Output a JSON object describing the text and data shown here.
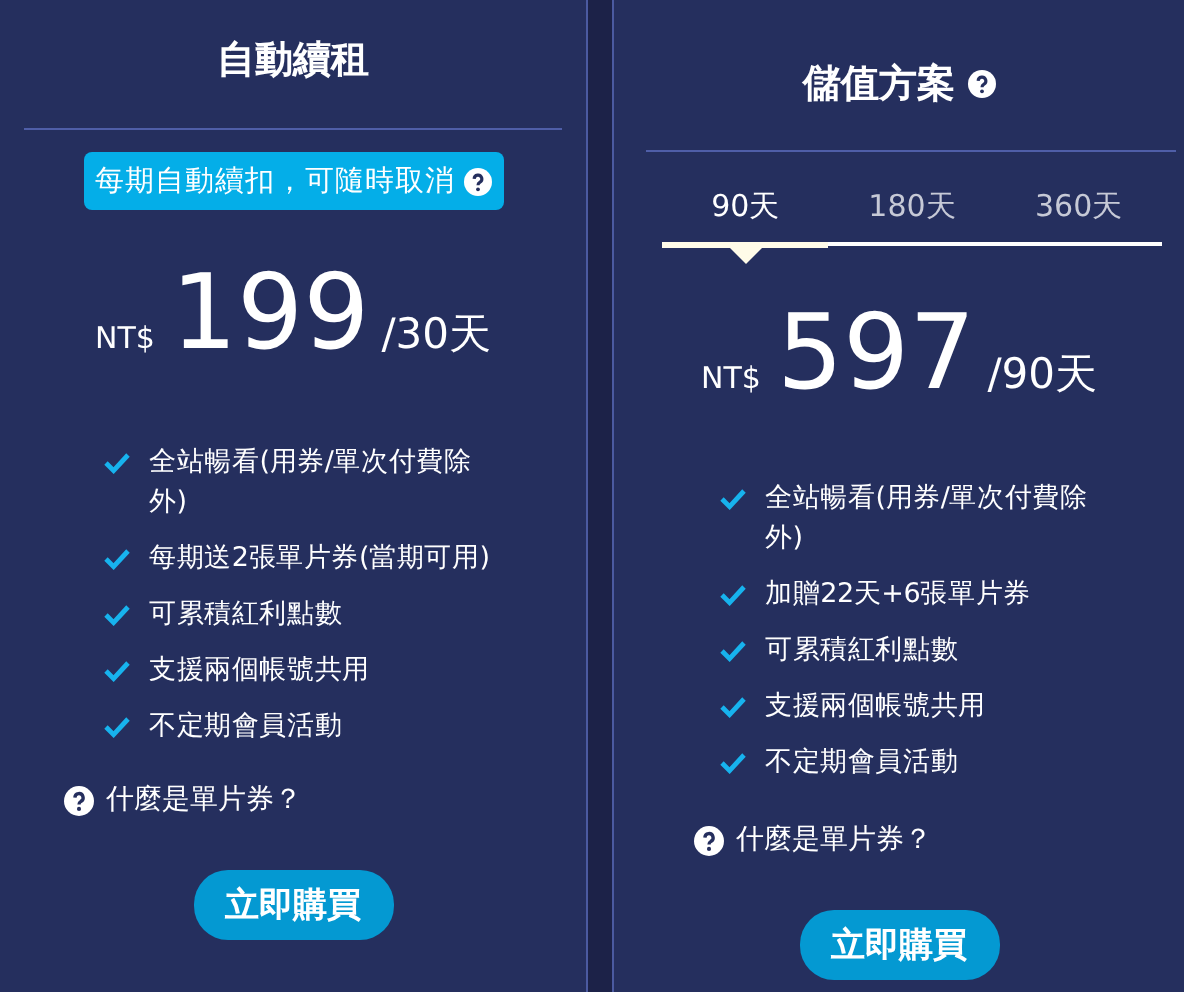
{
  "auto_renew": {
    "title": "自動續租",
    "badge": {
      "text": "每期自動續扣，可隨時取消",
      "help": true
    },
    "price": {
      "currency": "NT$",
      "amount": "199",
      "period": "/30天"
    },
    "features": [
      "全站暢看(用券/單次付費除外)",
      "每期送2張單片券(當期可用)",
      "可累積紅利點數",
      "支援兩個帳號共用",
      "不定期會員活動"
    ],
    "help_link": "什麼是單片券？",
    "buy_button": "立即購買"
  },
  "stored_value": {
    "title": "儲值方案",
    "title_help": true,
    "tabs": [
      {
        "label": "90天",
        "selected": true
      },
      {
        "label": "180天",
        "selected": false
      },
      {
        "label": "360天",
        "selected": false
      }
    ],
    "price": {
      "currency": "NT$",
      "amount": "597",
      "period": "/90天"
    },
    "features": [
      "全站暢看(用券/單次付費除外)",
      "加贈22天+6張單片券",
      "可累積紅利點數",
      "支援兩個帳號共用",
      "不定期會員活動"
    ],
    "help_link": "什麼是單片券？",
    "buy_button": "立即購買"
  }
}
